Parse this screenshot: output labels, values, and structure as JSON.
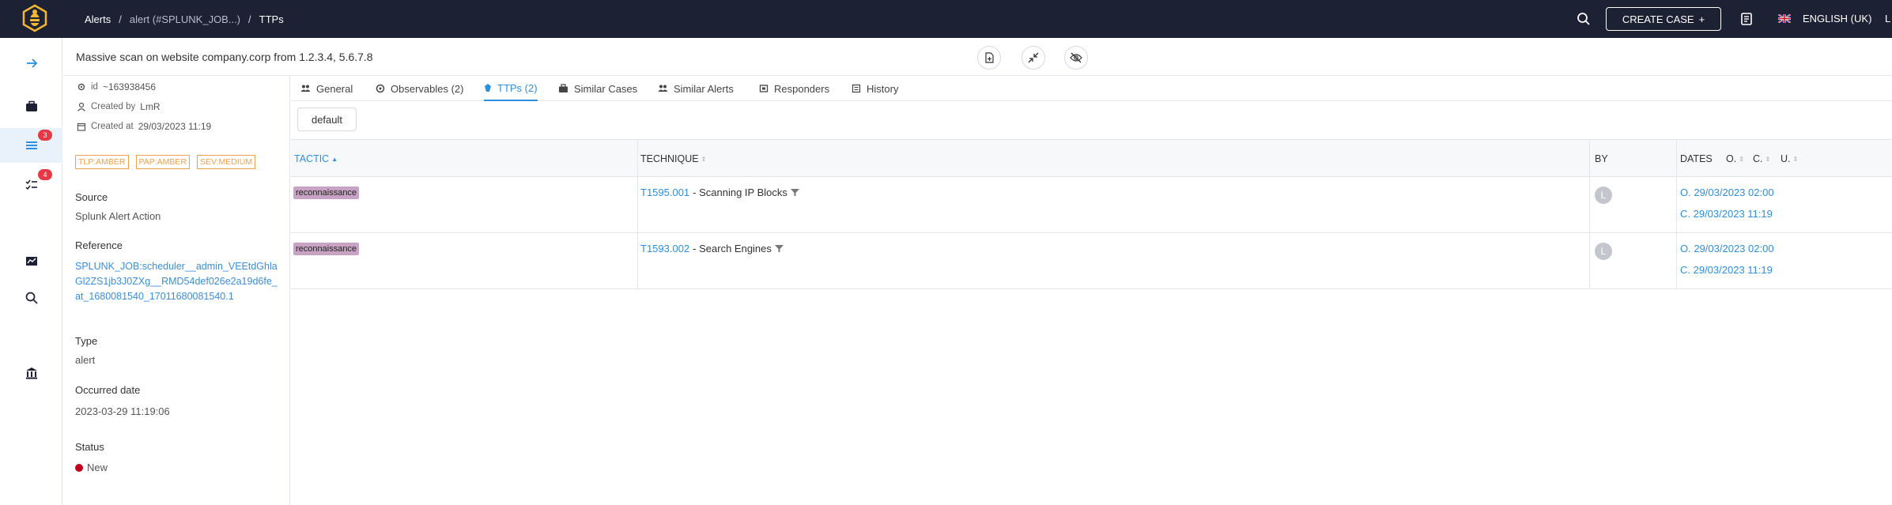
{
  "topbar": {
    "breadcrumbs": [
      "Alerts",
      "alert (#SPLUNK_JOB...)",
      "TTPs"
    ],
    "separator": "/",
    "create_case_label": "CREATE CASE",
    "create_case_plus": "+",
    "language": "ENGLISH (UK)",
    "language_overflow": "L"
  },
  "leftnav": {
    "alerts_badge": "3",
    "tasks_badge": "4"
  },
  "alert": {
    "title": "Massive scan on website company.corp from 1.2.3.4, 5.6.7.8"
  },
  "details": {
    "id_label": "id",
    "id_value": "~163938456",
    "created_by_label": "Created by",
    "created_by_value": "LmR",
    "created_at_label": "Created at",
    "created_at_value": "29/03/2023 11:19",
    "tags": [
      "TLP:AMBER",
      "PAP:AMBER",
      "SEV:MEDIUM"
    ],
    "source_label": "Source",
    "source_value": "Splunk Alert Action",
    "reference_label": "Reference",
    "reference_value": "SPLUNK_JOB:scheduler__admin_VEEtdGhlaGl2ZS1jb3J0ZXg__RMD54def026e2a19d6fe_at_1680081540_17011680081540.1",
    "type_label": "Type",
    "type_value": "alert",
    "occurred_label": "Occurred date",
    "occurred_value": "2023-03-29 11:19:06",
    "status_label": "Status",
    "status_value": "New",
    "status_color": "#c00016"
  },
  "tabs": [
    {
      "label": "General"
    },
    {
      "label": "Observables (2)"
    },
    {
      "label": "TTPs (2)"
    },
    {
      "label": "Similar Cases"
    },
    {
      "label": "Similar Alerts"
    },
    {
      "label": "Responders"
    },
    {
      "label": "History"
    }
  ],
  "filter_button": "default",
  "table": {
    "headers": {
      "tactic": "TACTIC",
      "technique": "TECHNIQUE",
      "by": "BY",
      "dates": "DATES",
      "o": "O.",
      "c": "C.",
      "u": "U."
    },
    "rows": [
      {
        "tactic": "reconnaissance",
        "technique_code": "T1595.001",
        "technique_name": " - Scanning IP Blocks",
        "by": "L",
        "occurred": "O. 29/03/2023 02:00",
        "created": "C. 29/03/2023 11:19"
      },
      {
        "tactic": "reconnaissance",
        "technique_code": "T1593.002",
        "technique_name": " - Search Engines",
        "by": "L",
        "occurred": "O. 29/03/2023 02:00",
        "created": "C. 29/03/2023 11:19"
      }
    ]
  },
  "colors": {
    "topbar_bg": "#1d2134",
    "accent": "#2d8fe0",
    "tag_amber": "#f0a14a",
    "badge_red": "#e53945",
    "tactic_pill": "#c9a3c4"
  }
}
